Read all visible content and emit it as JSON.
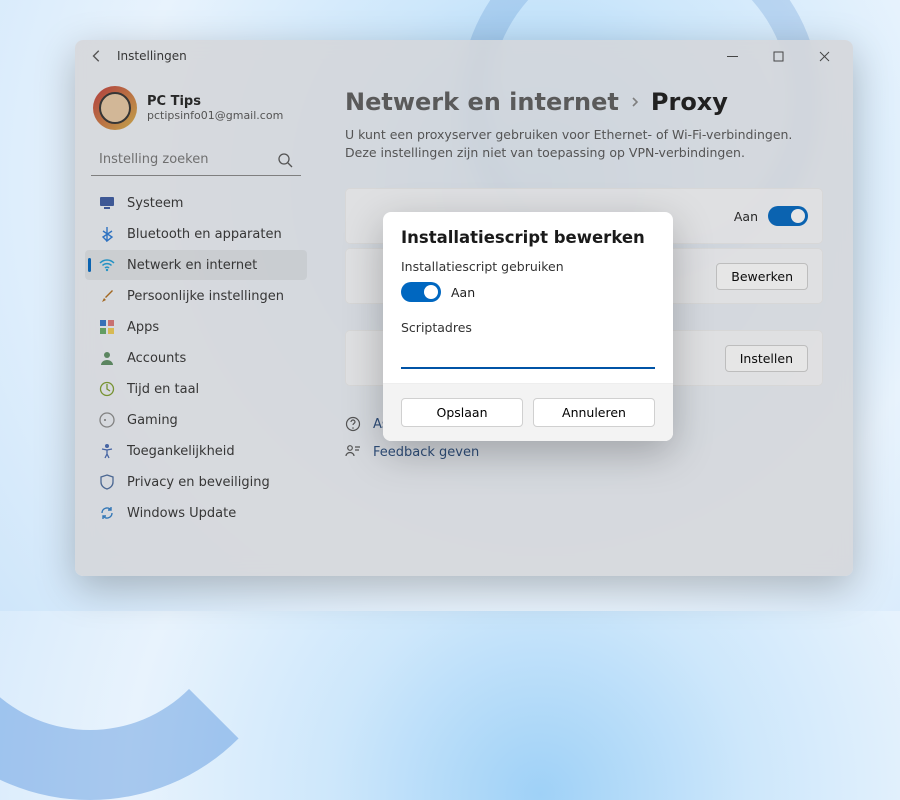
{
  "app_title": "Instellingen",
  "profile": {
    "name": "PC Tips",
    "email": "pctipsinfo01@gmail.com"
  },
  "search": {
    "placeholder": "Instelling zoeken"
  },
  "sidebar": {
    "items": [
      {
        "label": "Systeem"
      },
      {
        "label": "Bluetooth en apparaten"
      },
      {
        "label": "Netwerk en internet"
      },
      {
        "label": "Persoonlijke instellingen"
      },
      {
        "label": "Apps"
      },
      {
        "label": "Accounts"
      },
      {
        "label": "Tijd en taal"
      },
      {
        "label": "Gaming"
      },
      {
        "label": "Toegankelijkheid"
      },
      {
        "label": "Privacy en beveiliging"
      },
      {
        "label": "Windows Update"
      }
    ]
  },
  "page": {
    "crumb_parent": "Netwerk en internet",
    "crumb_title": "Proxy",
    "description": "U kunt een proxyserver gebruiken voor Ethernet- of Wi-Fi-verbindingen. Deze instellingen zijn niet van toepassing op VPN-verbindingen.",
    "card1": {
      "toggle_label": "Aan"
    },
    "card2": {
      "button": "Bewerken"
    },
    "card3": {
      "button": "Instellen"
    }
  },
  "help": {
    "assist": "Assistentie",
    "feedback": "Feedback geven"
  },
  "dialog": {
    "title": "Installatiescript bewerken",
    "use_label": "Installatiescript gebruiken",
    "toggle_label": "Aan",
    "field_label": "Scriptadres",
    "value": "",
    "save": "Opslaan",
    "cancel": "Annuleren"
  }
}
